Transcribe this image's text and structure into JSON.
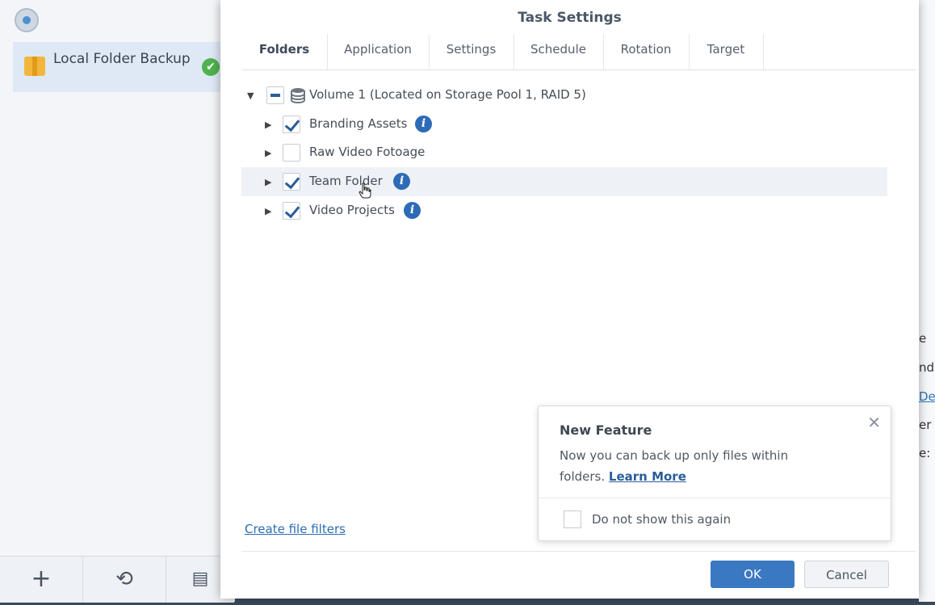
{
  "sidebar": {
    "task": {
      "label": "Local Folder Backup",
      "status": "success"
    },
    "bottom_icons": [
      "add-icon",
      "history-icon",
      "log-icon"
    ]
  },
  "dialog": {
    "title": "Task Settings",
    "tabs": [
      {
        "label": "Folders",
        "active": true
      },
      {
        "label": "Application"
      },
      {
        "label": "Settings"
      },
      {
        "label": "Schedule"
      },
      {
        "label": "Rotation"
      },
      {
        "label": "Target"
      }
    ],
    "tree": {
      "root": {
        "label": "Volume 1 (Located on Storage Pool 1, RAID 5)",
        "state": "partial",
        "expanded": true
      },
      "children": [
        {
          "label": "Branding Assets",
          "checked": true,
          "info": true
        },
        {
          "label": "Raw Video Fotoage",
          "checked": false,
          "info": false
        },
        {
          "label": "Team Folder",
          "checked": true,
          "info": true,
          "highlighted": true
        },
        {
          "label": "Video Projects",
          "checked": true,
          "info": true
        }
      ]
    },
    "create_filters_link": "Create file filters",
    "ok_label": "OK",
    "cancel_label": "Cancel"
  },
  "popup": {
    "title": "New Feature",
    "text": "Now you can back up only files within folders.",
    "link": "Learn More",
    "checkbox_label": "Do not show this again"
  },
  "background_fragments": [
    "e",
    "ndi",
    "De",
    "er",
    "e:"
  ],
  "colors": {
    "accent": "#3b78c2",
    "check": "#2a5d98",
    "success": "#4fb24f",
    "selected_bg": "#dfe9f5"
  }
}
